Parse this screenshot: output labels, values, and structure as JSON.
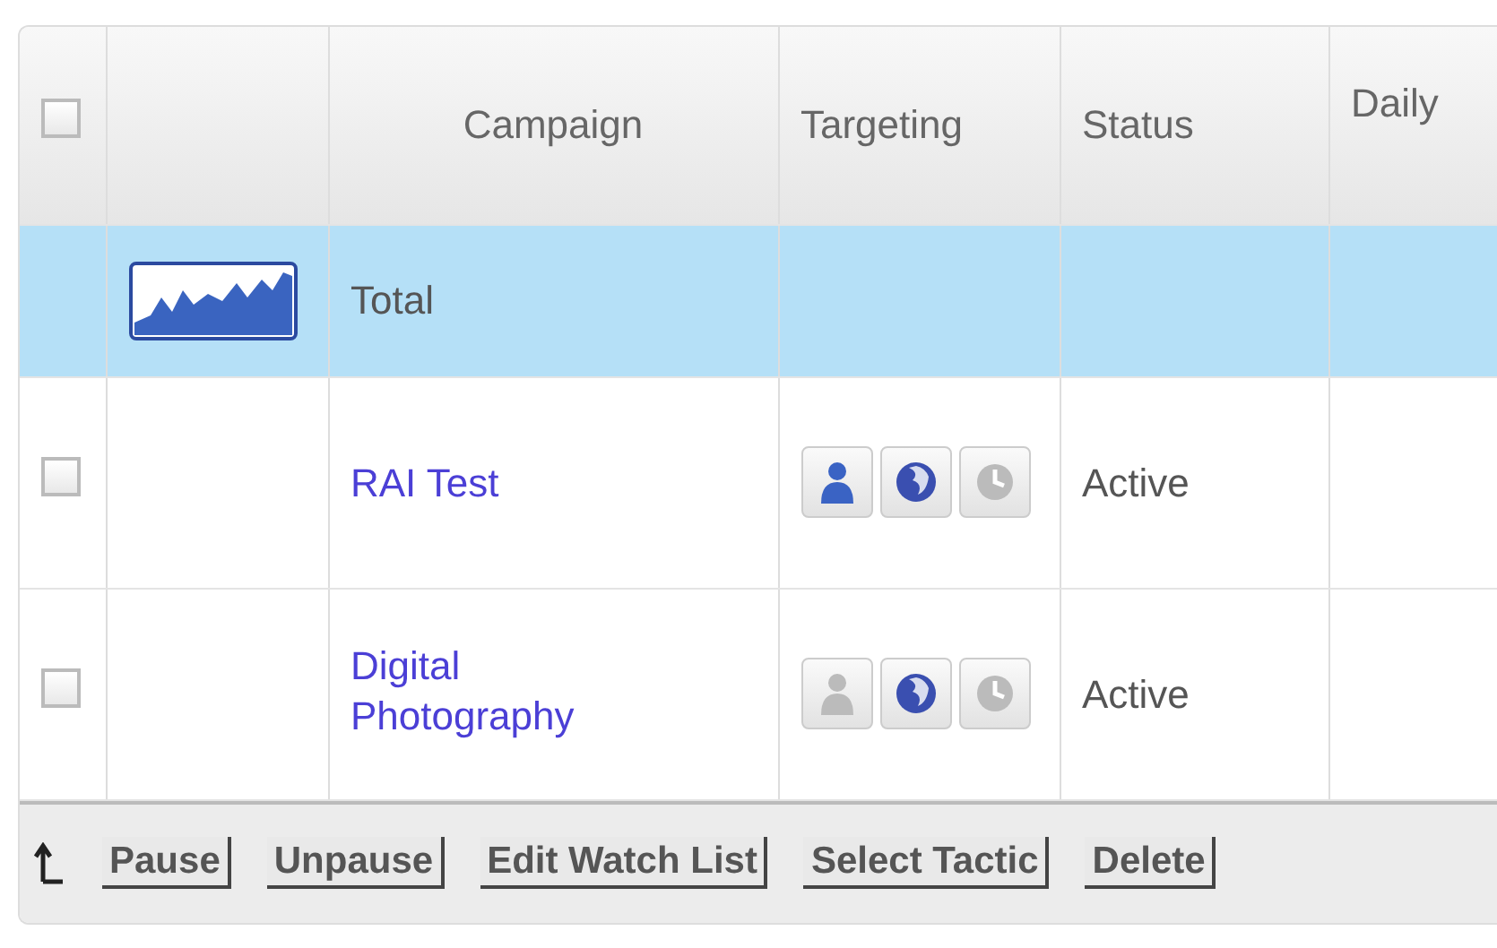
{
  "table": {
    "columns": [
      {
        "kind": "checkbox",
        "checked": false
      },
      {
        "kind": "blank"
      },
      {
        "kind": "text",
        "label": "Campaign"
      },
      {
        "kind": "text",
        "label": "Targeting"
      },
      {
        "kind": "text",
        "label": "Status"
      },
      {
        "kind": "text",
        "label": "Daily"
      }
    ],
    "total_row": {
      "label": "Total",
      "selected": true
    },
    "rows": [
      {
        "checked": false,
        "campaign": "RAI Test",
        "status": "Active",
        "targeting": [
          {
            "kind": "person",
            "active": true
          },
          {
            "kind": "globe",
            "active": true
          },
          {
            "kind": "clock",
            "active": false
          }
        ]
      },
      {
        "checked": false,
        "campaign": "Digital Photography",
        "status": "Active",
        "targeting": [
          {
            "kind": "person",
            "active": false
          },
          {
            "kind": "globe",
            "active": true
          },
          {
            "kind": "clock",
            "active": false
          }
        ]
      }
    ]
  },
  "actions": [
    "Pause",
    "Unpause",
    "Edit Watch List",
    "Select Tactic",
    "Delete"
  ]
}
